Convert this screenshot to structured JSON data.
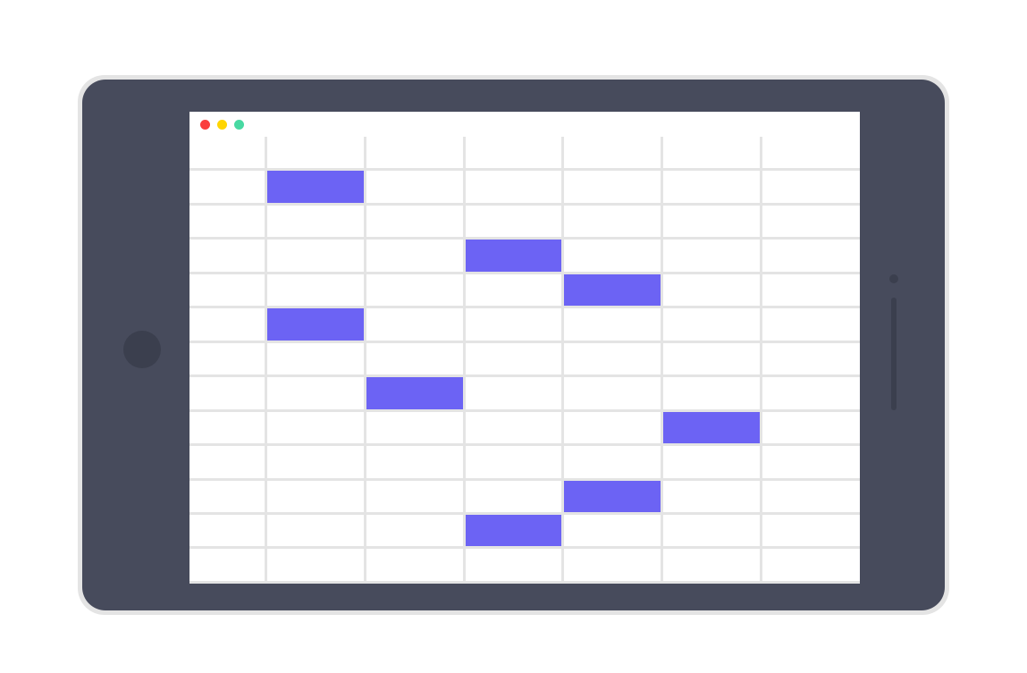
{
  "window_controls": {
    "close_color": "#fa3e3d",
    "minimize_color": "#ffd501",
    "maximize_color": "#48d9a2"
  },
  "accent_color": "#6c63f4",
  "grid": {
    "rows": 13,
    "cols": 7,
    "filled_cells": [
      {
        "row": 1,
        "col": 1
      },
      {
        "row": 3,
        "col": 3
      },
      {
        "row": 4,
        "col": 4
      },
      {
        "row": 5,
        "col": 1
      },
      {
        "row": 7,
        "col": 2
      },
      {
        "row": 8,
        "col": 5
      },
      {
        "row": 10,
        "col": 4
      },
      {
        "row": 11,
        "col": 3
      }
    ]
  }
}
